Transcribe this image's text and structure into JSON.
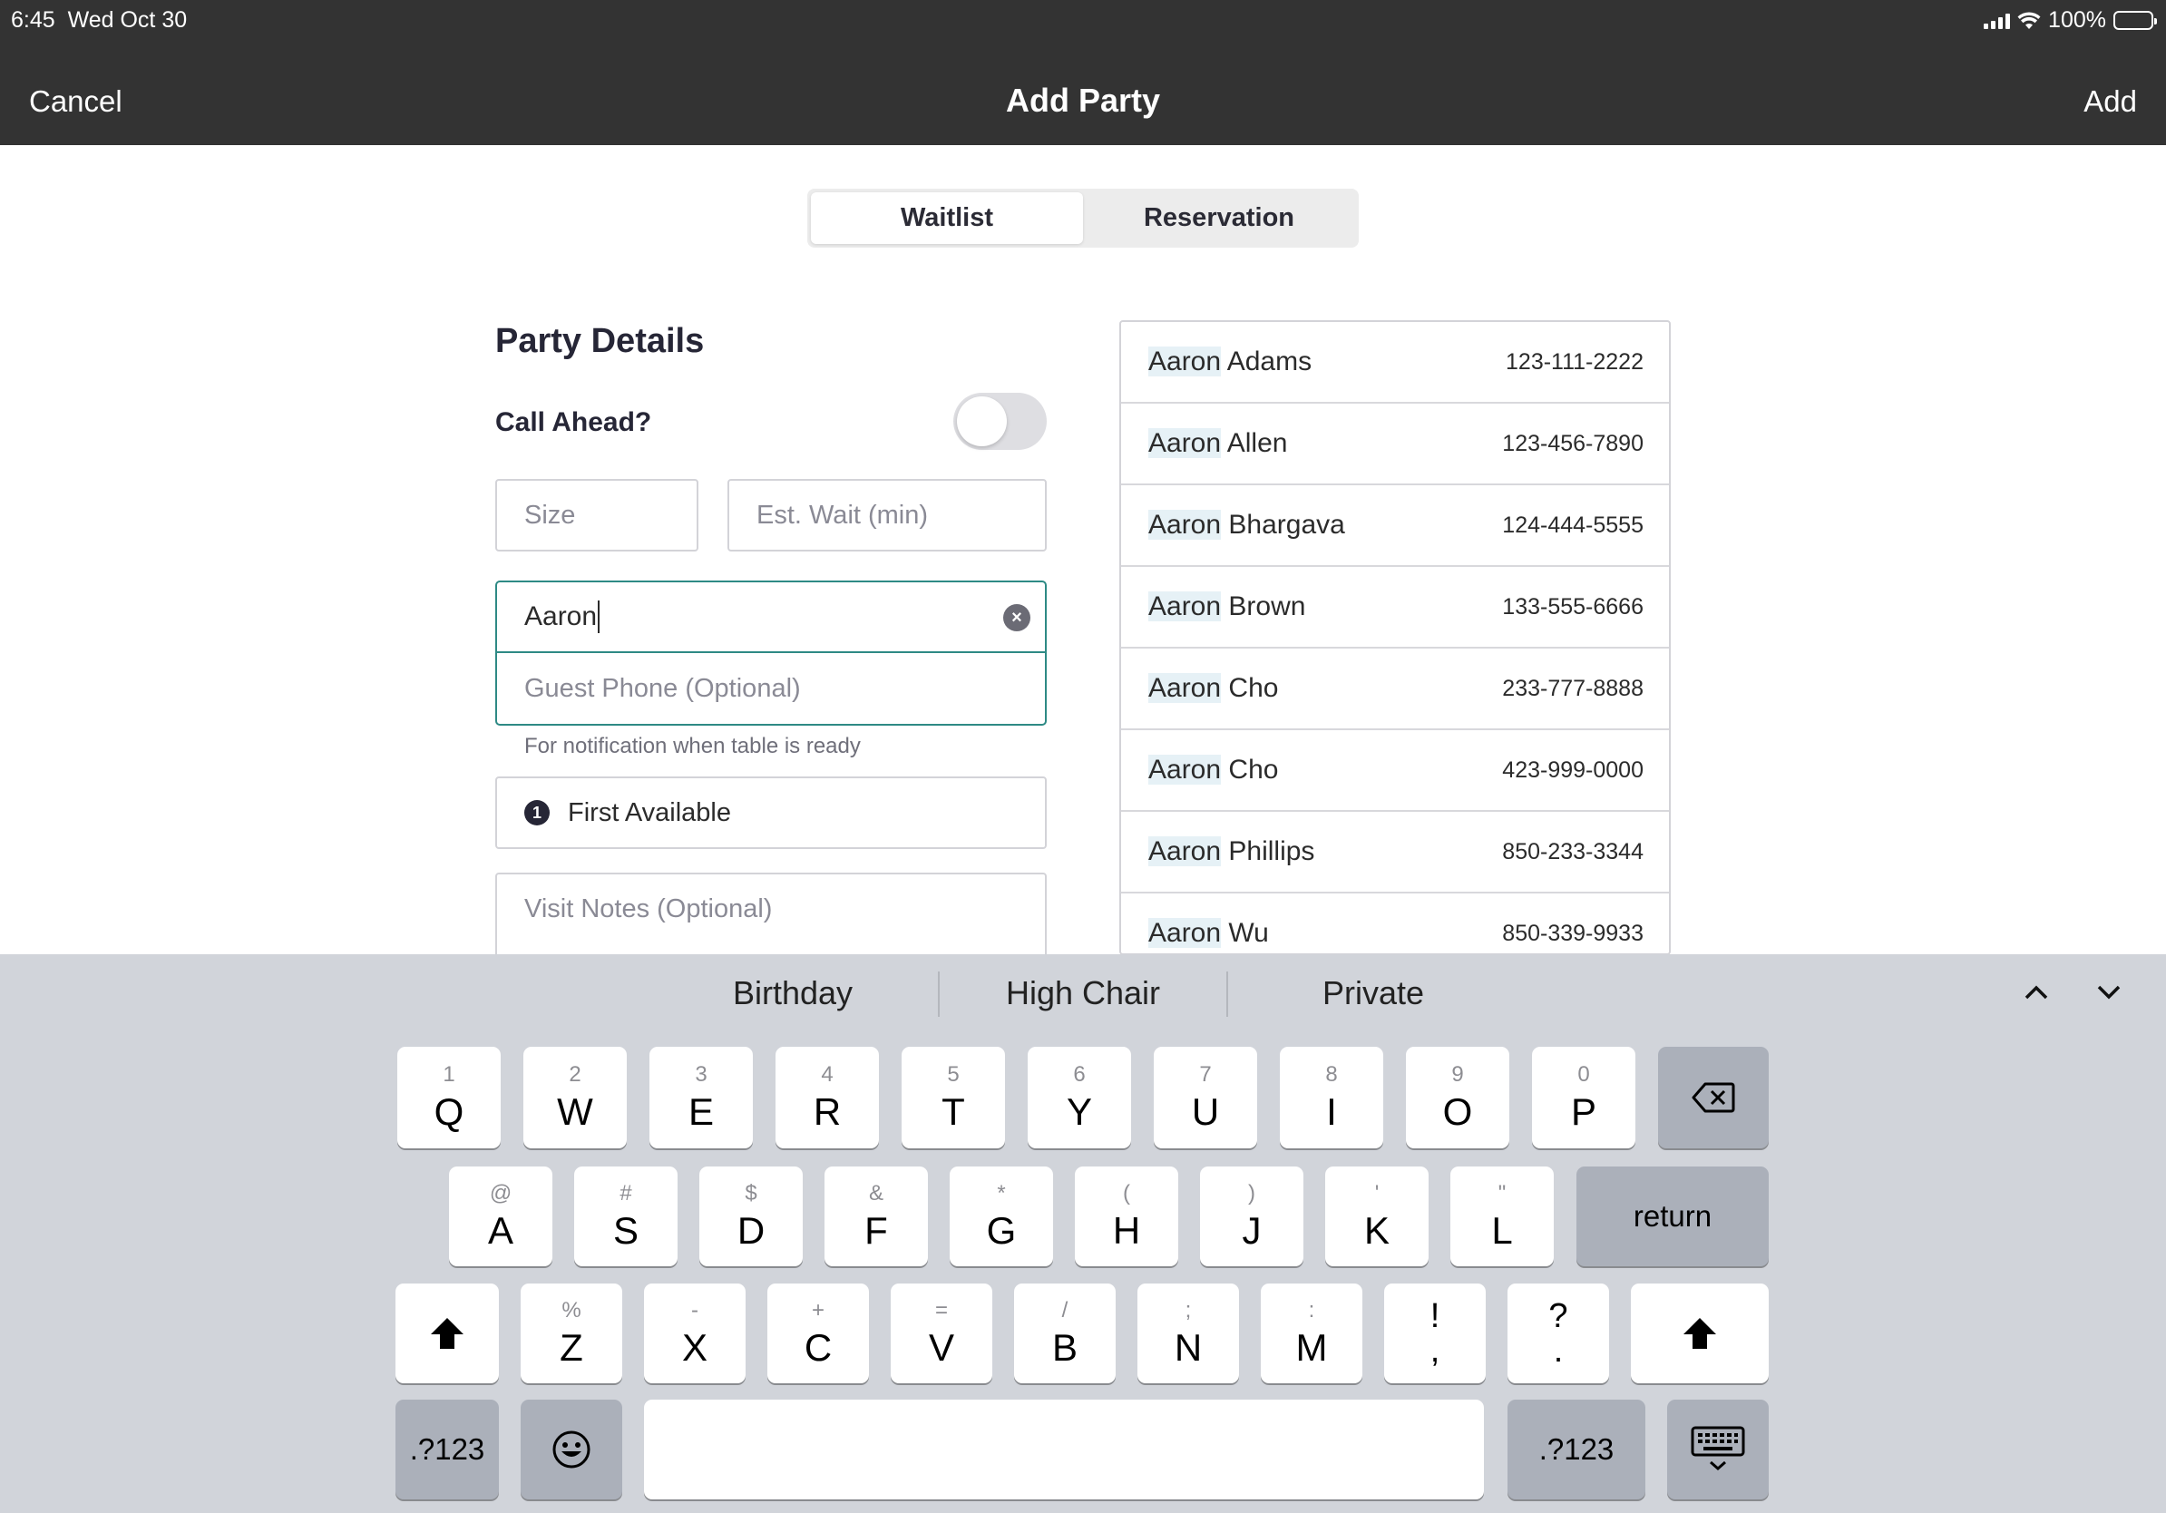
{
  "status": {
    "time": "6:45",
    "date": "Wed Oct 30",
    "battery": "100%"
  },
  "nav": {
    "cancel": "Cancel",
    "title": "Add Party",
    "add": "Add"
  },
  "segments": {
    "waitlist": "Waitlist",
    "reservation": "Reservation",
    "selected": "Waitlist"
  },
  "form": {
    "section_title": "Party Details",
    "call_ahead_label": "Call Ahead?",
    "call_ahead_on": false,
    "size_placeholder": "Size",
    "wait_placeholder": "Est. Wait (min)",
    "name_value": "Aaron",
    "phone_placeholder": "Guest Phone (Optional)",
    "phone_hint": "For notification when table is ready",
    "seating_badge": "1",
    "seating_label": "First Available",
    "notes_placeholder": "Visit Notes (Optional)"
  },
  "suggestions": [
    {
      "match": "Aaron",
      "rest": " Adams",
      "phone": "123-111-2222"
    },
    {
      "match": "Aaron",
      "rest": " Allen",
      "phone": "123-456-7890"
    },
    {
      "match": "Aaron",
      "rest": " Bhargava",
      "phone": "124-444-5555"
    },
    {
      "match": "Aaron",
      "rest": " Brown",
      "phone": "133-555-6666"
    },
    {
      "match": "Aaron",
      "rest": " Cho",
      "phone": "233-777-8888"
    },
    {
      "match": "Aaron",
      "rest": " Cho",
      "phone": "423-999-0000"
    },
    {
      "match": "Aaron",
      "rest": " Phillips",
      "phone": "850-233-3344"
    },
    {
      "match": "Aaron",
      "rest": " Wu",
      "phone": "850-339-9933"
    }
  ],
  "keyboard": {
    "predictions": [
      "Birthday",
      "High Chair",
      "Private"
    ],
    "row1": [
      {
        "hint": "1",
        "key": "Q"
      },
      {
        "hint": "2",
        "key": "W"
      },
      {
        "hint": "3",
        "key": "E"
      },
      {
        "hint": "4",
        "key": "R"
      },
      {
        "hint": "5",
        "key": "T"
      },
      {
        "hint": "6",
        "key": "Y"
      },
      {
        "hint": "7",
        "key": "U"
      },
      {
        "hint": "8",
        "key": "I"
      },
      {
        "hint": "9",
        "key": "O"
      },
      {
        "hint": "0",
        "key": "P"
      }
    ],
    "row2": [
      {
        "hint": "@",
        "key": "A"
      },
      {
        "hint": "#",
        "key": "S"
      },
      {
        "hint": "$",
        "key": "D"
      },
      {
        "hint": "&",
        "key": "F"
      },
      {
        "hint": "*",
        "key": "G"
      },
      {
        "hint": "(",
        "key": "H"
      },
      {
        "hint": ")",
        "key": "J"
      },
      {
        "hint": "'",
        "key": "K"
      },
      {
        "hint": "\"",
        "key": "L"
      }
    ],
    "row3": [
      {
        "hint": "%",
        "key": "Z"
      },
      {
        "hint": "-",
        "key": "X"
      },
      {
        "hint": "+",
        "key": "C"
      },
      {
        "hint": "=",
        "key": "V"
      },
      {
        "hint": "/",
        "key": "B"
      },
      {
        "hint": ";",
        "key": "N"
      },
      {
        "hint": ":",
        "key": "M"
      },
      {
        "hint": "!",
        "key": ","
      },
      {
        "hint": "?",
        "key": "."
      }
    ],
    "return_label": "return",
    "numbers_label": ".?123"
  }
}
